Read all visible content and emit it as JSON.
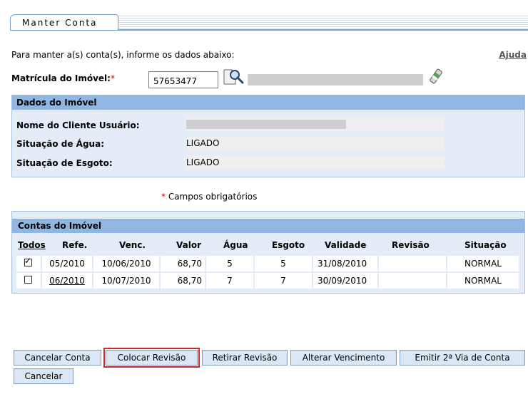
{
  "title": "Manter Conta",
  "intro_text": "Para manter a(s) conta(s), informe os dados abaixo:",
  "help_link": "Ajuda",
  "matricula": {
    "label": "Matrícula do Imóvel:",
    "required_mark": "*",
    "value": "57653477"
  },
  "dados_imovel": {
    "header": "Dados do Imóvel",
    "fields": [
      {
        "label": "Nome do Cliente Usuário:",
        "value": ""
      },
      {
        "label": "Situação de Água:",
        "value": "LIGADO"
      },
      {
        "label": "Situação de Esgoto:",
        "value": "LIGADO"
      }
    ]
  },
  "required_note": {
    "mark": "*",
    "text": " Campos obrigatórios"
  },
  "contas": {
    "header": "Contas do Imóvel",
    "columns": [
      "Todos",
      "Refe.",
      "Venc.",
      "Valor",
      "Água",
      "Esgoto",
      "Validade",
      "Revisão",
      "Situação"
    ],
    "rows": [
      {
        "checked": true,
        "ref": "05/2010",
        "venc": "10/06/2010",
        "valor": "68,70",
        "agua": "5",
        "esgoto": "5",
        "validade": "31/08/2010",
        "revisao": "",
        "situacao": "NORMAL"
      },
      {
        "checked": false,
        "ref": "06/2010",
        "venc": "10/07/2010",
        "valor": "68,70",
        "agua": "7",
        "esgoto": "7",
        "validade": "30/09/2010",
        "revisao": "",
        "situacao": "NORMAL"
      }
    ]
  },
  "buttons": {
    "cancelar_conta": "Cancelar Conta",
    "colocar_revisao": "Colocar Revisão",
    "retirar_revisao": "Retirar Revisão",
    "alterar_vencimento": "Alterar Vencimento",
    "emitir_2via": "Emitir 2ª Via de Conta",
    "cancelar": "Cancelar"
  },
  "colors": {
    "panel_header": "#90b6e2",
    "panel_bg": "#e3ecf7",
    "required": "#d00000",
    "highlight": "#cc2a2a"
  }
}
